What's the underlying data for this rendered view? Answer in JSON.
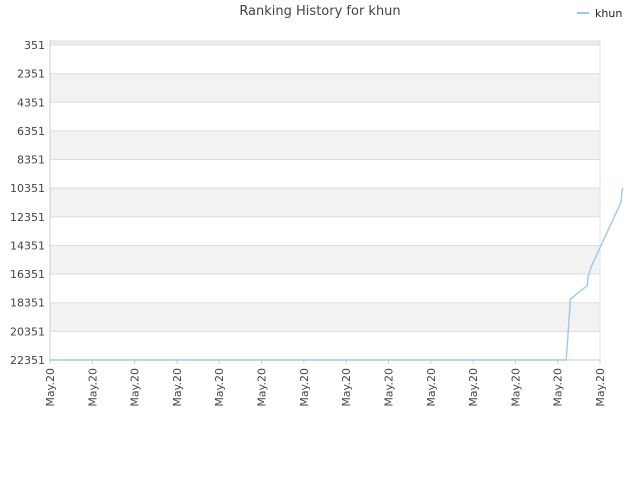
{
  "chart_data": {
    "type": "line",
    "title": "Ranking History for khun",
    "xlabel": "",
    "ylabel": "",
    "ylim": [
      351,
      22351
    ],
    "y_inverted": true,
    "y_ticks": [
      "351",
      "2351",
      "4351",
      "6351",
      "8351",
      "10351",
      "12351",
      "14351",
      "16351",
      "18351",
      "20351",
      "22351"
    ],
    "x_ticks": [
      "May.20",
      "May.20",
      "May.20",
      "May.20",
      "May.20",
      "May.20",
      "May.20",
      "May.20",
      "May.20",
      "May.20",
      "May.20",
      "May.20",
      "May.20",
      "May.20"
    ],
    "grid": true,
    "legend_position": "top-right",
    "series": [
      {
        "name": "khun",
        "color": "#9fc8ee",
        "points": [
          [
            0,
            22351
          ],
          [
            12.2,
            22351
          ],
          [
            12.25,
            20300
          ],
          [
            12.3,
            18100
          ],
          [
            12.7,
            17150
          ],
          [
            12.72,
            16500
          ],
          [
            12.8,
            15800
          ],
          [
            13.5,
            11300
          ],
          [
            13.52,
            10450
          ],
          [
            13.55,
            10350
          ]
        ]
      }
    ]
  }
}
